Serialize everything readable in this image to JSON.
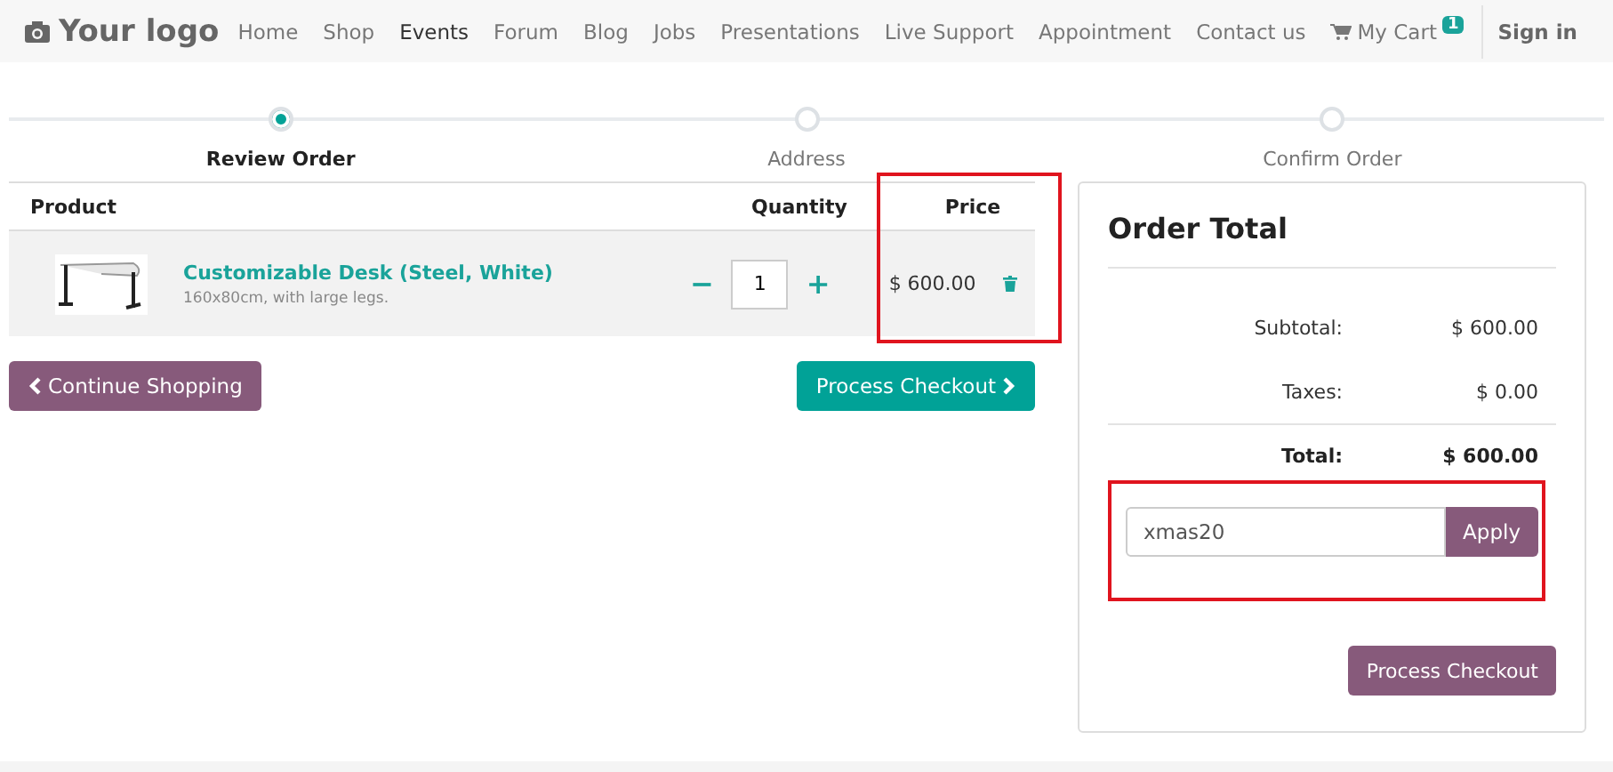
{
  "header": {
    "logo": "Your logo",
    "nav": [
      {
        "label": "Home",
        "selected": false
      },
      {
        "label": "Shop",
        "selected": false
      },
      {
        "label": "Events",
        "selected": true
      },
      {
        "label": "Forum",
        "selected": false
      },
      {
        "label": "Blog",
        "selected": false
      },
      {
        "label": "Jobs",
        "selected": false
      },
      {
        "label": "Presentations",
        "selected": false
      },
      {
        "label": "Live Support",
        "selected": false
      },
      {
        "label": "Appointment",
        "selected": false
      },
      {
        "label": "Contact us",
        "selected": false
      }
    ],
    "cart": {
      "label": "My Cart",
      "count": "1"
    },
    "sign_in": "Sign in"
  },
  "steps": [
    {
      "label": "Review Order",
      "selected": true
    },
    {
      "label": "Address",
      "selected": false
    },
    {
      "label": "Confirm Order",
      "selected": false
    }
  ],
  "table": {
    "columns": [
      "Product",
      "Quantity",
      "Price"
    ],
    "rows": [
      {
        "name": "Customizable Desk (Steel, White)",
        "description": "160x80cm, with large legs.",
        "quantity": "1",
        "minus": "−",
        "plus": "+",
        "price": "$ 600.00"
      }
    ]
  },
  "continue_button": "Continue Shopping",
  "checkout_button": "Process Checkout",
  "order_total": {
    "title": "Order Total",
    "lines": [
      {
        "label": "Subtotal:",
        "value": "$ 600.00",
        "kind": "normal"
      },
      {
        "label": "Taxes:",
        "value": "$ 0.00",
        "kind": "normal"
      },
      {
        "label": "Total:",
        "value": "$ 600.00",
        "kind": "total"
      }
    ],
    "promo": {
      "value": "xmas20",
      "button": "Apply"
    },
    "checkout_button": "Process Checkout"
  }
}
